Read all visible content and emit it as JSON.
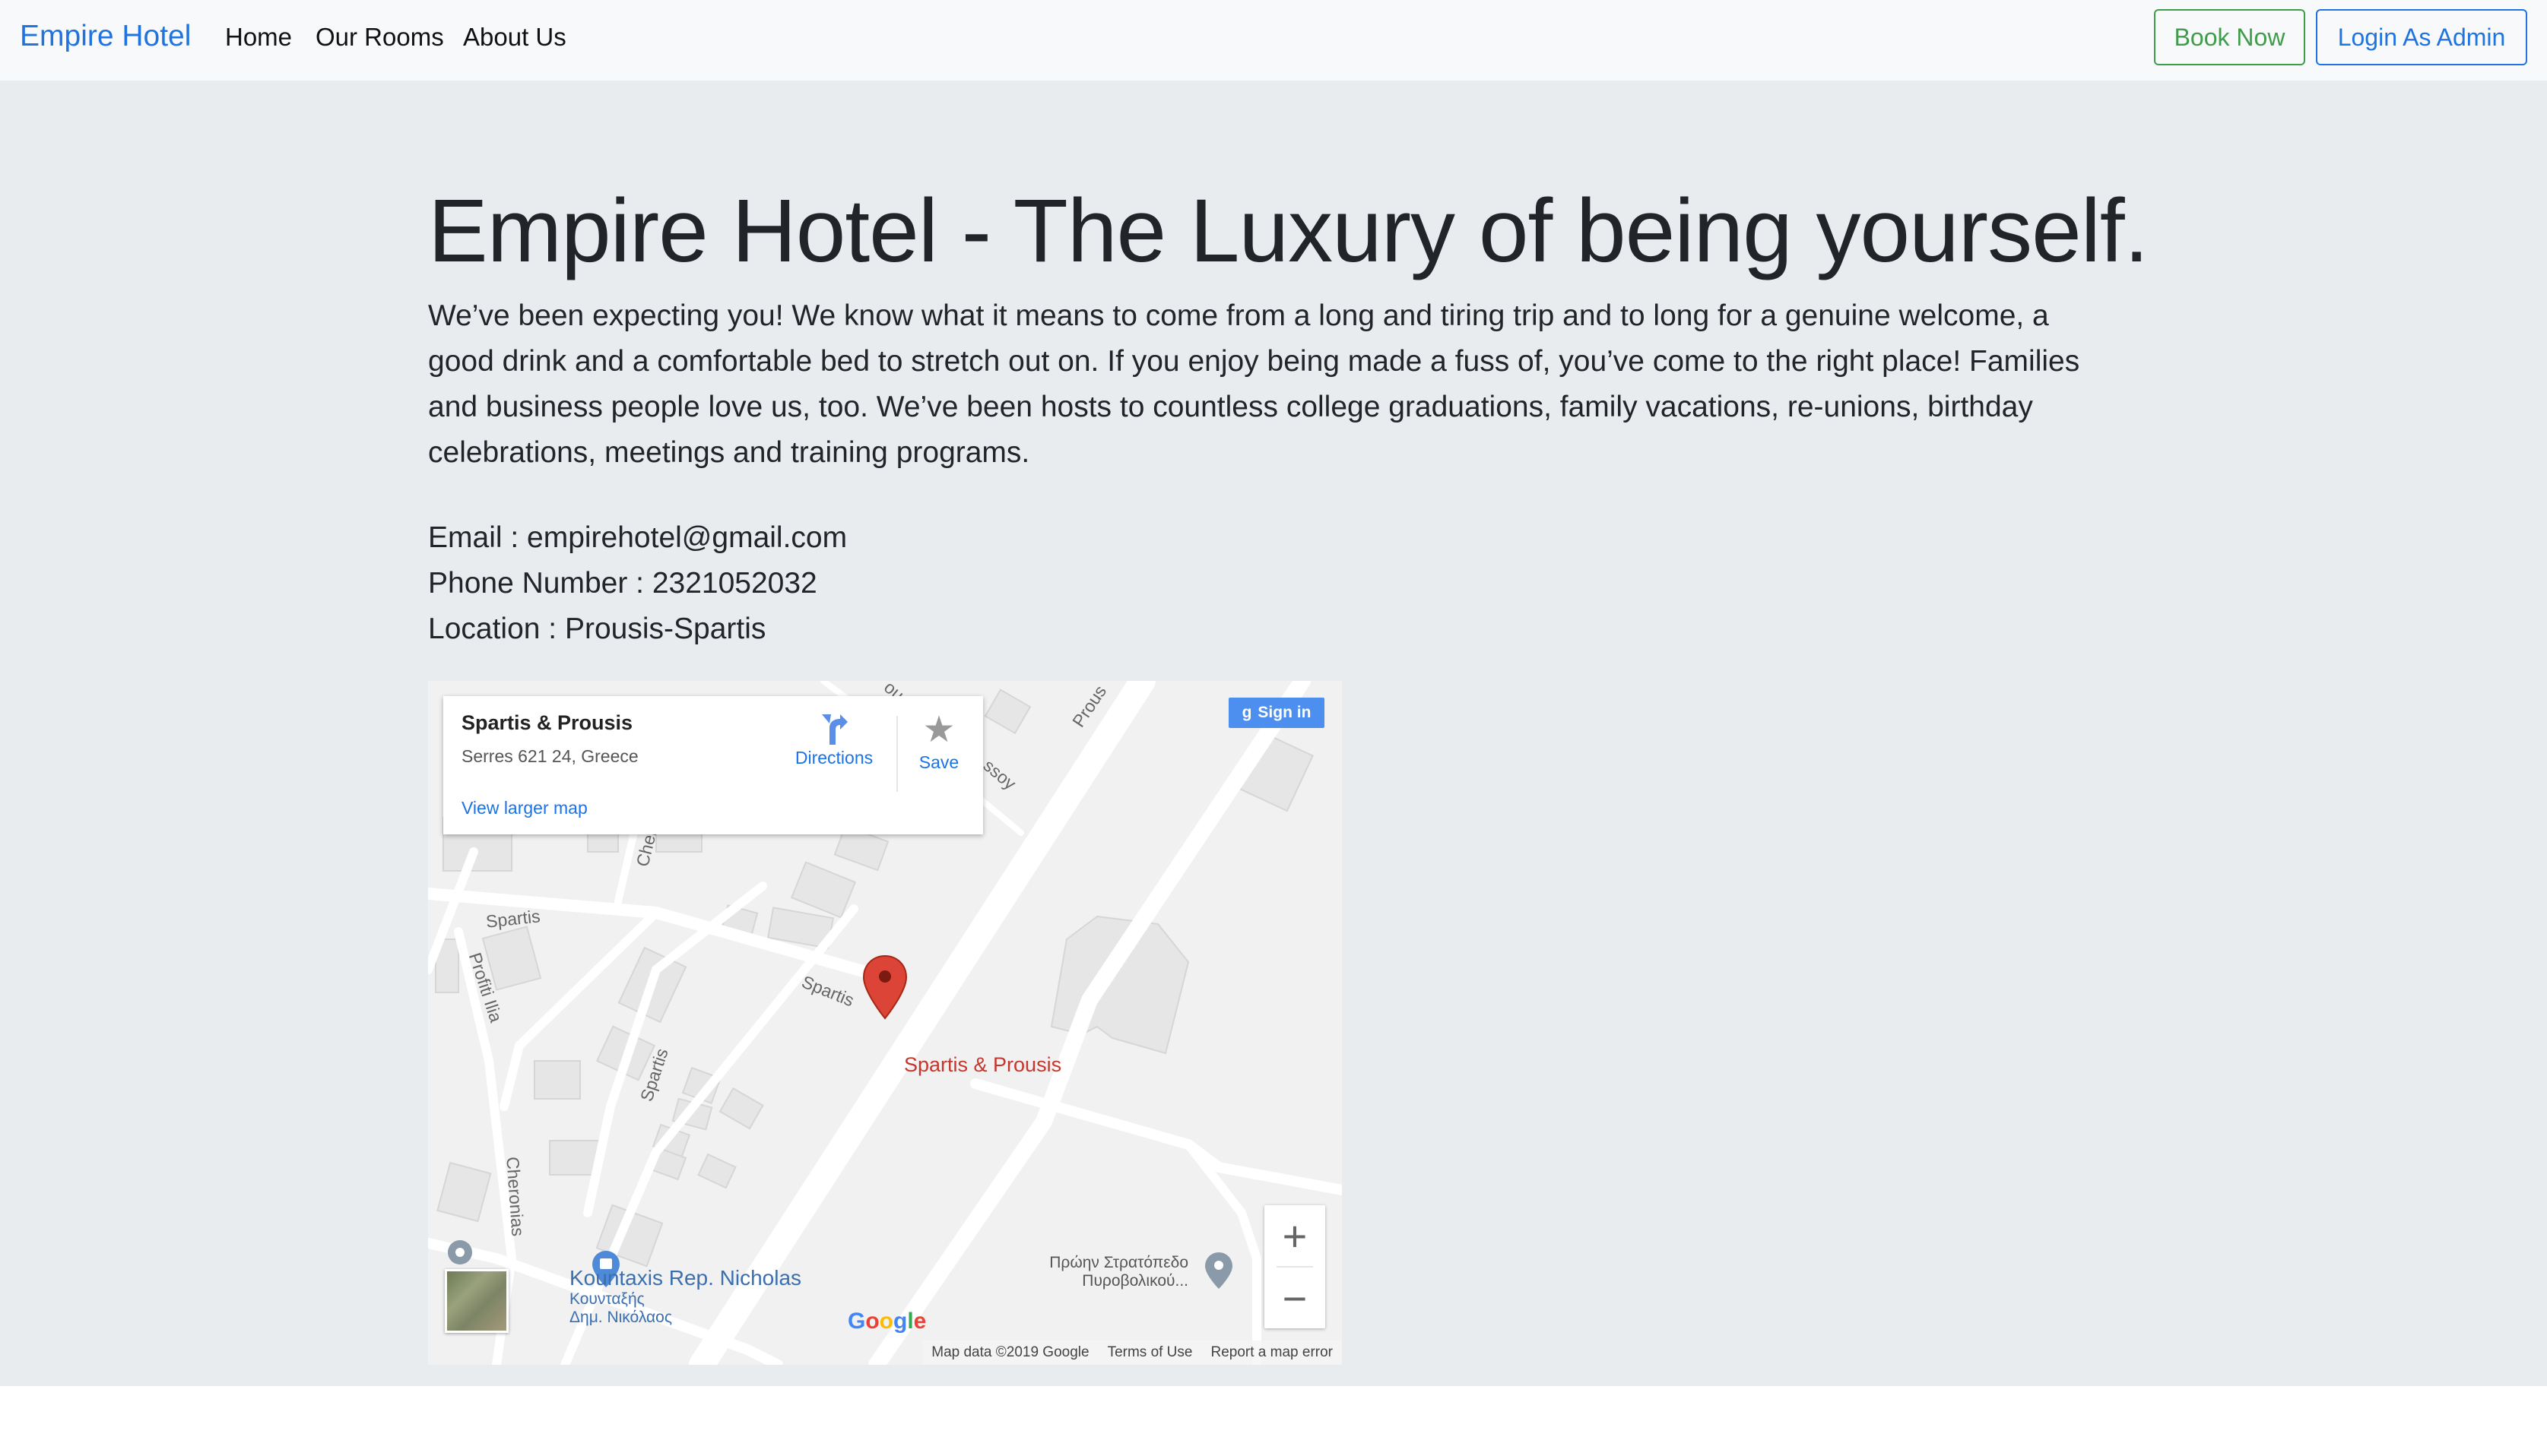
{
  "navbar": {
    "brand": "Empire Hotel",
    "links": [
      "Home",
      "Our Rooms",
      "About Us"
    ],
    "book_label": "Book Now",
    "admin_label": "Login As Admin"
  },
  "hero": {
    "title_strong": "Empire Hotel",
    "title_rest": " - The Luxury of being yourself.",
    "intro": "We’ve been expecting you! We know what it means to come from a long and tiring trip and to long for a genuine welcome, a good drink and a comfortable bed to stretch out on. If you enjoy being made a fuss of, you’ve come to the right place! Families and business people love us, too. We’ve been hosts to countless college graduations, family vacations, re-unions, birthday celebrations, meetings and training programs.",
    "email": "Email : empirehotel@gmail.com",
    "phone": "Phone Number : 2321052032",
    "location": "Location : Prousis-Spartis"
  },
  "map": {
    "place_name": "Spartis & Prousis",
    "place_address": "Serres 621 24, Greece",
    "larger_map_link": "View larger map",
    "directions_label": "Directions",
    "save_label": "Save",
    "signin_label": "Sign in",
    "pin_label": "Spartis & Prousis",
    "poi_name": "Kountaxis Rep. Nicholas",
    "poi_greek_line1": "Κουνταξής",
    "poi_greek_line2": "Δημ. Νικόλαος",
    "poi2_line1": "Πρώην Στρατόπεδο",
    "poi2_line2": "Πυροβολικού...",
    "zoom_in": "+",
    "zoom_out": "−",
    "google_logo": "Google",
    "attrib_data": "Map data ©2019 Google",
    "attrib_terms": "Terms of Use",
    "attrib_report": "Report a map error",
    "road_labels": {
      "spartis1": "Spartis",
      "spartis2": "Spartis",
      "spartis3": "Spartis",
      "profiti": "Profiti Ilia",
      "cheronias1": "Chero",
      "cheronias2": "Cheronias",
      "prousis": "Prous",
      "prousis2": "ssoy",
      "top": "ou"
    }
  },
  "colors": {
    "brand": "#1f74e0",
    "book_button": "#3f9c4a",
    "jumbotron_bg": "#e9ecef",
    "pin": "#db4437"
  }
}
